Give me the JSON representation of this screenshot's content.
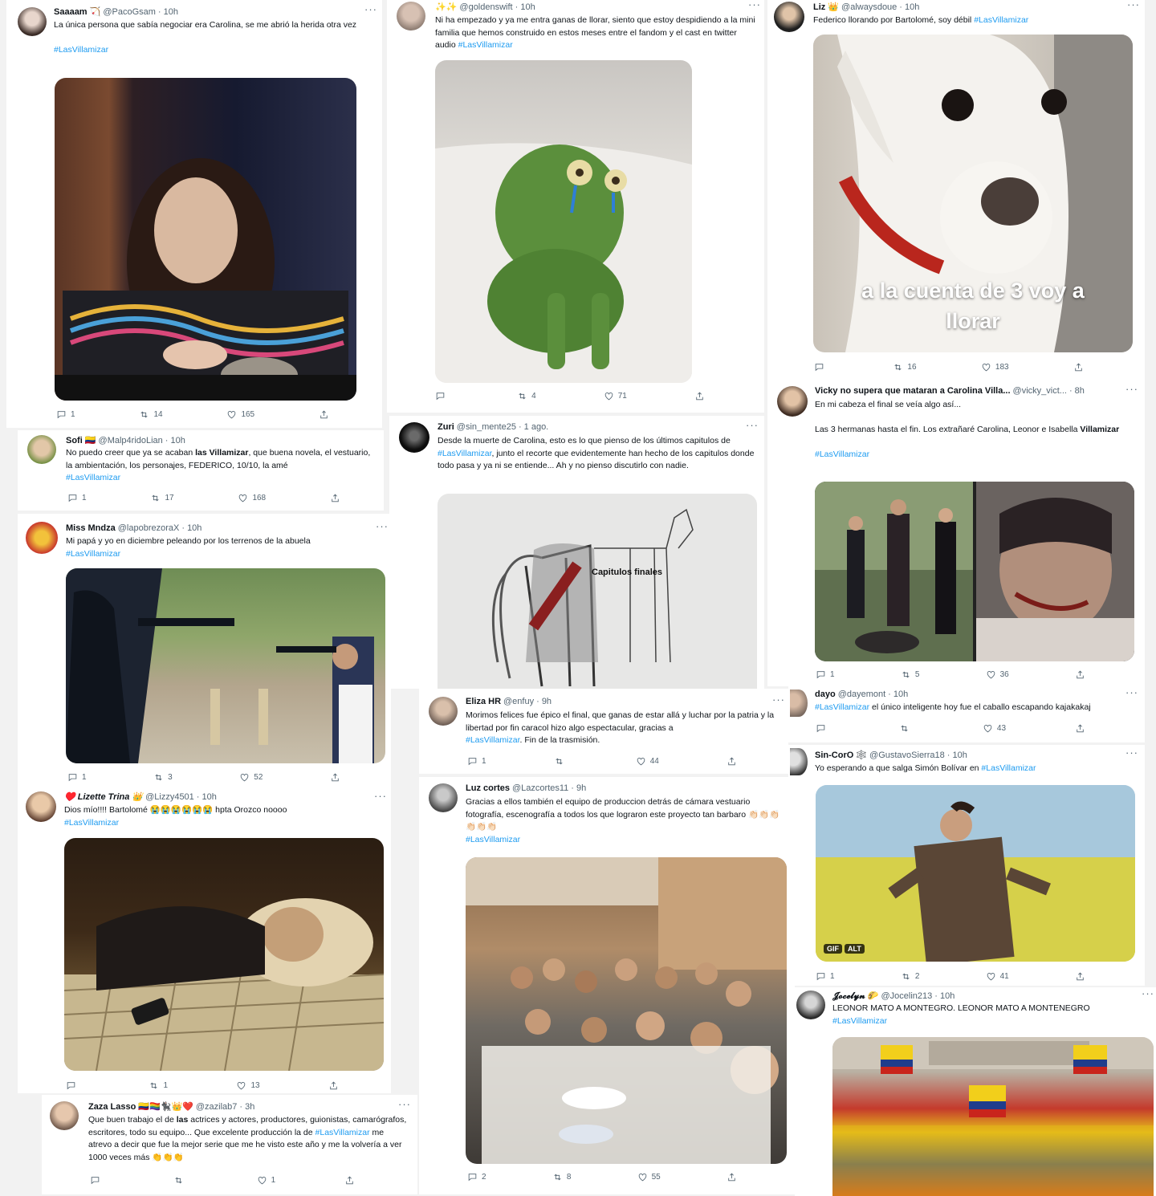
{
  "tweets": {
    "t1": {
      "name": "Saaaam 🏹",
      "handle": "@PacoGsam",
      "time": "· 10h",
      "text": "La única persona que sabía negociar era Carolina, se me abrió la herida otra vez",
      "tag": "#LasVillamizar",
      "reply": "1",
      "retweet": "14",
      "like": "165"
    },
    "t2": {
      "name": "✨✨",
      "handle": "@goldenswift",
      "time": "· 10h",
      "text": "Ni ha empezado y ya me entra ganas de llorar, siento que estoy despidiendo a la mini familia que hemos construido en estos meses entre el fandom y el cast en twitter audio",
      "tag": "#LasVillamizar",
      "reply": "",
      "retweet": "4",
      "like": "71"
    },
    "t3": {
      "name": "Liz 👑",
      "handle": "@alwaysdoue",
      "time": "· 10h",
      "text": "Federico llorando por Bartolomé, soy débil",
      "tag": "#LasVillamizar",
      "caption": "a la cuenta de 3 voy a llorar",
      "reply": "",
      "retweet": "16",
      "like": "183"
    },
    "t4": {
      "name": "Sofi 🇨🇴",
      "handle": "@Malp4ridoLian",
      "time": "· 10h",
      "text_a": "No puedo creer que ya se acaban ",
      "text_bold": "las Villamizar",
      "text_b": ", que buena novela, el vestuario, la ambientación, los personajes, FEDERICO, 10/10, la amé",
      "tag": "#LasVillamizar",
      "reply": "1",
      "retweet": "17",
      "like": "168"
    },
    "t5": {
      "name": "Zuri",
      "handle": "@sin_mente25",
      "time": "· 1 ago.",
      "text_a": "Desde la muerte de Carolina, esto es lo que pienso de los últimos capitulos de ",
      "tag": "#LasVillamizar",
      "text_b": ", junto el recorte que evidentemente han hecho de los capitulos donde todo pasa y ya ni se entiende... Ah y no pienso discutirlo con nadie.",
      "img_label": "Capitulos finales"
    },
    "t6": {
      "name": "Vicky no supera que mataran a Carolina Villa...",
      "handle": "@vicky_vict...",
      "time": "· 8h",
      "line1": "En mi cabeza el final se veía algo así...",
      "line2_a": "Las 3 hermanas hasta el fin. Los extrañaré Carolina, Leonor e Isabella ",
      "line2_bold": "Villamizar",
      "tag": "#LasVillamizar",
      "reply": "1",
      "retweet": "5",
      "like": "36"
    },
    "t7": {
      "name": "Miss Mndza",
      "handle": "@lapobrezoraX",
      "time": "· 10h",
      "text": "Mi papá y yo en diciembre peleando por los terrenos de la abuela",
      "tag": "#LasVillamizar",
      "reply": "1",
      "retweet": "3",
      "like": "52"
    },
    "t8": {
      "name": "Eliza HR",
      "handle": "@enfuy",
      "time": "· 9h",
      "text": "Morimos felices fue épico el final, que ganas de estar allá y luchar por la patria y la libertad por fin caracol hizo algo espectacular, gracias a",
      "tag": "#LasVillamizar",
      "text_b": ". Fin de la trasmisión.",
      "reply": "1",
      "retweet": "",
      "like": "44"
    },
    "t9": {
      "name": "dayo",
      "handle": "@dayemont",
      "time": "· 10h",
      "tag": "#LasVillamizar",
      "text": " el único inteligente hoy fue el caballo escapando kajakakaj",
      "reply": "",
      "retweet": "",
      "like": "43"
    },
    "t10": {
      "name": "Sin-CorO 🕸️",
      "handle": "@GustavoSierra18",
      "time": "· 10h",
      "text": "Yo esperando a que salga Simón Bolívar en ",
      "tag": "#LasVillamizar",
      "gif": "GIF",
      "alt": "ALT",
      "reply": "1",
      "retweet": "2",
      "like": "41"
    },
    "t11": {
      "name": "♥️ Lizette Trina 👑",
      "handle": "@Lizzy4501",
      "time": "· 10h",
      "text": "Dios mío!!!! Bartolomé 😭😭😭😭😭😭 hpta Orozco noooo",
      "tag": "#LasVillamizar",
      "reply": "",
      "retweet": "1",
      "like": "13"
    },
    "t12": {
      "name": "Luz cortes",
      "handle": "@Lazcortes11",
      "time": "· 9h",
      "text": "Gracias a ellos también el equipo de produccion detrás de cámara vestuario fotografía, escenografía a todos los que lograron este proyecto tan barbaro 👏🏻👏🏻👏🏻👏🏻👏🏻👏🏻",
      "tag": "#LasVillamizar",
      "reply": "2",
      "retweet": "8",
      "like": "55"
    },
    "t13": {
      "name": "Zaza Lasso 🇨🇴🏳️‍🌈🐈‍⬛👑❤️",
      "handle": "@zazilab7",
      "time": "· 3h",
      "text_a": "Que buen trabajo el de ",
      "text_bold": "las",
      "text_b": " actrices y actores, productores, guionistas, camarógrafos, escritores, todo su equipo... Que excelente producción la de ",
      "tag": "#LasVillamizar",
      "text_c": " me atrevo a decir que fue la mejor serie que me he visto este año y me la volvería a ver 1000 veces más 👏👏👏",
      "reply": "",
      "retweet": "",
      "like": "1"
    },
    "t14": {
      "name": "𝓙𝓸𝓬𝓮𝓵𝔂𝓷 🌮",
      "handle": "@Jocelin213",
      "time": "· 10h",
      "text": "LEONOR MATO A MONTEGRO. LEONOR MATO A MONTENEGRO",
      "tag": "#LasVillamizar"
    }
  },
  "icons": [
    "reply-icon",
    "retweet-icon",
    "like-icon",
    "share-icon",
    "more-icon"
  ],
  "colors": {
    "link": "#1d9bf0",
    "text": "#0f1419",
    "muted": "#536471"
  }
}
